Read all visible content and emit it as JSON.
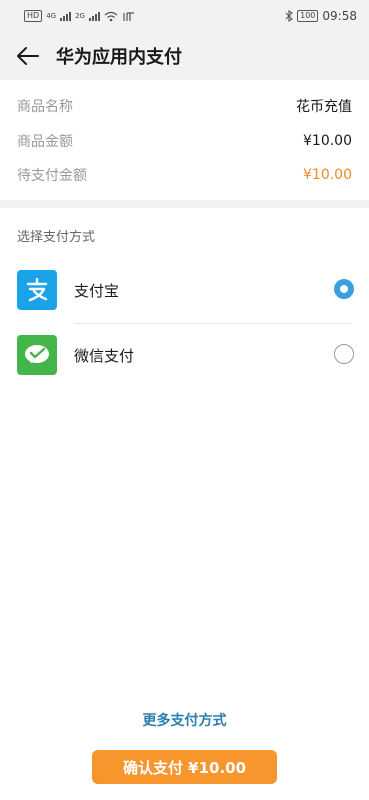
{
  "status_bar": {
    "left_badge": "HD",
    "net1": "4G",
    "net2": "2G",
    "time": "09:58",
    "battery": "100"
  },
  "header": {
    "title": "华为应用内支付"
  },
  "order": {
    "rows": [
      {
        "label": "商品名称",
        "value": "花币充值"
      },
      {
        "label": "商品金额",
        "value": "¥10.00"
      },
      {
        "label": "待支付金额",
        "value": "¥10.00"
      }
    ]
  },
  "payment": {
    "section_title": "选择支付方式",
    "options": [
      {
        "name": "支付宝",
        "selected": true,
        "color": "#1aa3e8"
      },
      {
        "name": "微信支付",
        "selected": false,
        "color": "#44b549"
      }
    ],
    "more_label": "更多支付方式",
    "confirm_label": "确认支付 ¥10.00"
  },
  "colors": {
    "accent": "#f7962d",
    "link": "#2a7fad",
    "radio_on": "#3a9fde"
  }
}
